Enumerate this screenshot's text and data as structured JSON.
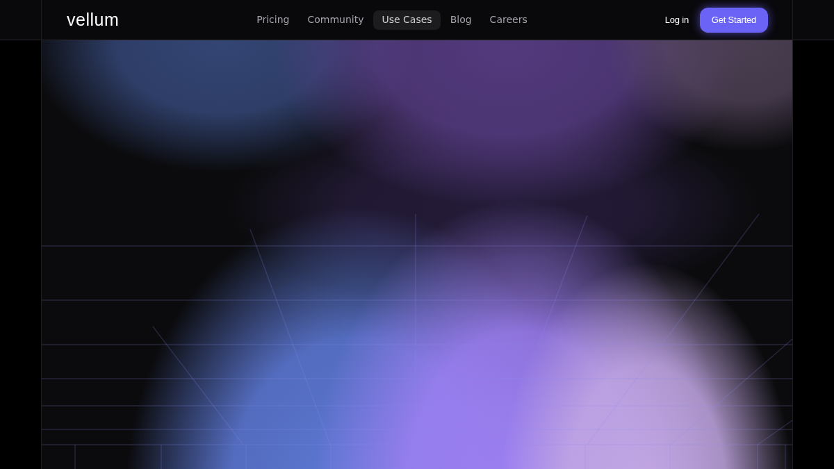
{
  "header": {
    "logo": "vellum",
    "nav": [
      {
        "label": "Pricing",
        "selected": false
      },
      {
        "label": "Community",
        "selected": false
      },
      {
        "label": "Use Cases",
        "selected": true
      },
      {
        "label": "Blog",
        "selected": false
      },
      {
        "label": "Careers",
        "selected": false
      }
    ],
    "login": "Log in",
    "cta": "Get Started"
  }
}
